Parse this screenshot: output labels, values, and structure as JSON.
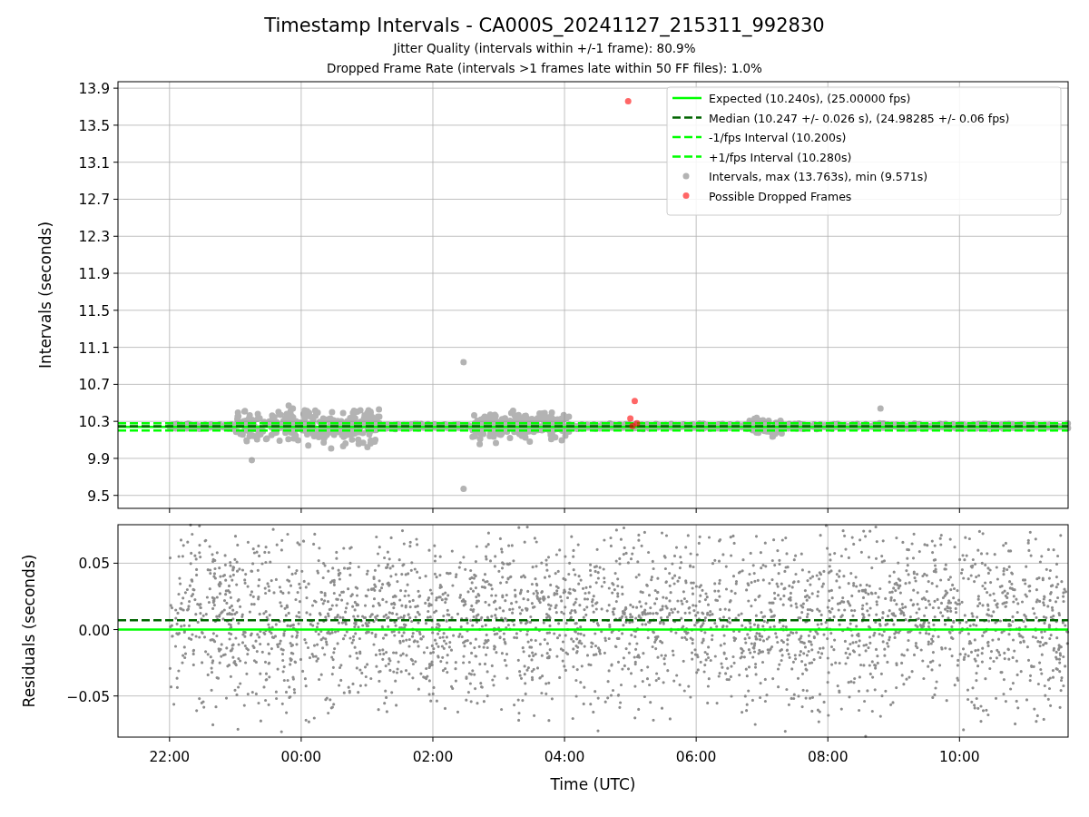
{
  "title": "Timestamp Intervals - CA000S_20241127_215311_992830",
  "subtitles": [
    "Jitter Quality (intervals within +/-1 frame): 80.9%",
    "Dropped Frame Rate (intervals >1 frames late within 50 FF files): 1.0%"
  ],
  "plots": [
    {
      "chart_data": {
        "type": "scatter",
        "ylabel": "Intervals (seconds)",
        "grid": true,
        "xlim": [
          "2024-11-27T21:13",
          "2024-11-28T11:39"
        ],
        "ylim": [
          9.36,
          13.97
        ],
        "yticks": [
          {
            "value": 9.5,
            "label": "9.5"
          },
          {
            "value": 9.9,
            "label": "9.9"
          },
          {
            "value": 10.3,
            "label": "10.3"
          },
          {
            "value": 10.7,
            "label": "10.7"
          },
          {
            "value": 11.1,
            "label": "11.1"
          },
          {
            "value": 11.5,
            "label": "11.5"
          },
          {
            "value": 11.9,
            "label": "11.9"
          },
          {
            "value": 12.3,
            "label": "12.3"
          },
          {
            "value": 12.7,
            "label": "12.7"
          },
          {
            "value": 13.1,
            "label": "13.1"
          },
          {
            "value": 13.5,
            "label": "13.5"
          },
          {
            "value": 13.9,
            "label": "13.9"
          }
        ],
        "legend": true,
        "series": [
          {
            "name": "Expected (10.240s), (25.00000 fps)",
            "type": "line",
            "color": "#00ff00",
            "x": [
              "2024-11-27T21:13",
              "2024-11-28T11:39"
            ],
            "values": [
              10.24,
              10.24
            ]
          },
          {
            "name": "Median (10.247 +/- 0.026 s), (24.98285 +/- 0.06 fps)",
            "type": "line",
            "line_style": "dashed",
            "color": "#006400",
            "x": [
              "2024-11-27T21:13",
              "2024-11-28T11:39"
            ],
            "values": [
              10.247,
              10.247
            ]
          },
          {
            "name": "-1/fps Interval (10.200s)",
            "type": "line",
            "line_style": "dashed",
            "color": "#00ff00",
            "x": [
              "2024-11-27T21:13",
              "2024-11-28T11:39"
            ],
            "values": [
              10.2,
              10.2
            ]
          },
          {
            "name": "+1/fps Interval (10.280s)",
            "type": "line",
            "line_style": "dashed",
            "color": "#00ff00",
            "x": [
              "2024-11-27T21:13",
              "2024-11-28T11:39"
            ],
            "values": [
              10.28,
              10.28
            ]
          },
          {
            "name": "Intervals, max (13.763s), min (9.571s)",
            "type": "scatter",
            "color": "#808080",
            "x": [
              "2024-11-28T02:28",
              "2024-11-28T02:28",
              "2024-11-27T23:15",
              "2024-11-28T08:48"
            ],
            "values": [
              10.94,
              9.57,
              9.88,
              10.44
            ]
          },
          {
            "name": "Possible Dropped Frames",
            "type": "scatter",
            "color": "#ff0000",
            "x": [
              "2024-11-28T04:58",
              "2024-11-28T05:04",
              "2024-11-28T05:00",
              "2024-11-28T05:06",
              "2024-11-28T05:02"
            ],
            "values": [
              13.76,
              10.52,
              10.33,
              10.28,
              10.25
            ]
          }
        ]
      }
    },
    {
      "chart_data": {
        "type": "scatter",
        "xlabel": "Time (UTC)",
        "ylabel": "Residuals (seconds)",
        "grid": true,
        "xlim": [
          "2024-11-27T21:13",
          "2024-11-28T11:39"
        ],
        "ylim": [
          -0.081,
          0.079
        ],
        "xticks": [
          {
            "value": "2024-11-27T22:00",
            "label": "22:00"
          },
          {
            "value": "2024-11-28T00:00",
            "label": "00:00"
          },
          {
            "value": "2024-11-28T02:00",
            "label": "02:00"
          },
          {
            "value": "2024-11-28T04:00",
            "label": "04:00"
          },
          {
            "value": "2024-11-28T06:00",
            "label": "06:00"
          },
          {
            "value": "2024-11-28T08:00",
            "label": "08:00"
          },
          {
            "value": "2024-11-28T10:00",
            "label": "10:00"
          }
        ],
        "yticks": [
          {
            "value": -0.05,
            "label": "−0.05"
          },
          {
            "value": 0,
            "label": "0.00"
          },
          {
            "value": 0.05,
            "label": "0.05"
          }
        ],
        "series": [
          {
            "type": "line",
            "color": "#00ff00",
            "x": [
              "2024-11-27T21:13",
              "2024-11-28T11:39"
            ],
            "values": [
              0,
              0
            ]
          },
          {
            "type": "line",
            "line_style": "dashed",
            "color": "#006400",
            "x": [
              "2024-11-27T21:13",
              "2024-11-28T11:39"
            ],
            "values": [
              0.007,
              0.007
            ]
          }
        ]
      }
    }
  ]
}
